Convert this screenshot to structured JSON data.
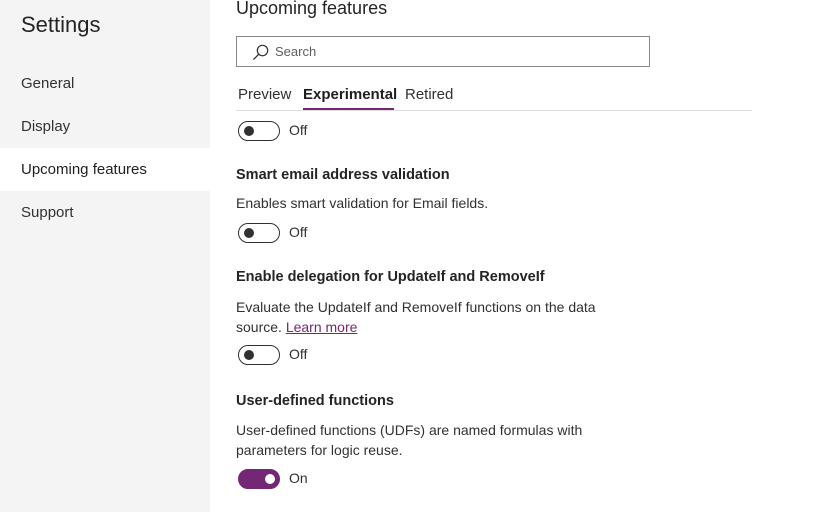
{
  "sidebar": {
    "title": "Settings",
    "items": [
      {
        "label": "General"
      },
      {
        "label": "Display"
      },
      {
        "label": "Upcoming features"
      },
      {
        "label": "Support"
      }
    ]
  },
  "main": {
    "title": "Upcoming features",
    "search": {
      "placeholder": "Search",
      "value": "",
      "icon": "search-icon"
    },
    "tabs": [
      {
        "label": "Preview"
      },
      {
        "label": "Experimental"
      },
      {
        "label": "Retired"
      }
    ],
    "active_tab": "Experimental",
    "features": [
      {
        "title": "",
        "description": "",
        "toggle_state": "Off",
        "enabled": false
      },
      {
        "title": "Smart email address validation",
        "description": "Enables smart validation for Email fields.",
        "toggle_state": "Off",
        "enabled": false
      },
      {
        "title": "Enable delegation for UpdateIf and RemoveIf",
        "description": "Evaluate the UpdateIf and RemoveIf functions on the data source.",
        "link": "Learn more",
        "toggle_state": "Off",
        "enabled": false
      },
      {
        "title": "User-defined functions",
        "description": "User-defined functions (UDFs) are named formulas with parameters for logic reuse.",
        "toggle_state": "On",
        "enabled": true
      }
    ]
  },
  "colors": {
    "accent": "#742774",
    "sidebar_bg": "#f4f4f4",
    "text": "#252423"
  }
}
